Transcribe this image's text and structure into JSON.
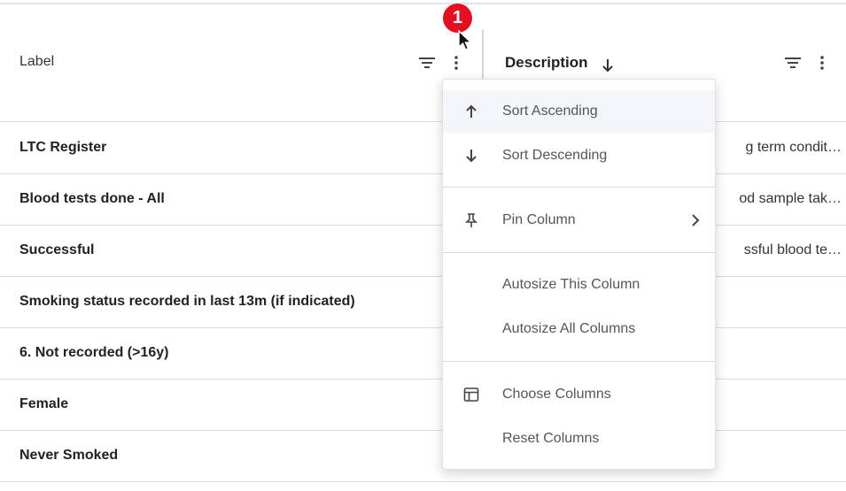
{
  "columns": {
    "label_header": "Label",
    "description_header": "Description"
  },
  "rows": [
    {
      "label": "LTC Register",
      "description": "g term condit…"
    },
    {
      "label": "Blood tests done - All",
      "description": "od sample tak…"
    },
    {
      "label": "Successful",
      "description": "ssful blood te…"
    },
    {
      "label": "Smoking status recorded in last 13m (if indicated)",
      "description": ""
    },
    {
      "label": "6. Not recorded (>16y)",
      "description": ""
    },
    {
      "label": "Female",
      "description": ""
    },
    {
      "label": "Never Smoked",
      "description": ""
    }
  ],
  "menu": {
    "sort_ascending": "Sort Ascending",
    "sort_descending": "Sort Descending",
    "pin_column": "Pin Column",
    "autosize_this": "Autosize This Column",
    "autosize_all": "Autosize All Columns",
    "choose_columns": "Choose Columns",
    "reset_columns": "Reset Columns"
  },
  "badge": {
    "number": "1"
  },
  "colors": {
    "badge": "#e3101f",
    "border": "#dcdcdc",
    "menu_hover": "#f3f5f8"
  }
}
